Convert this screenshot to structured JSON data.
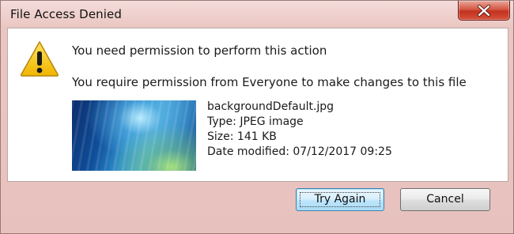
{
  "dialog": {
    "title": "File Access Denied",
    "heading": "You need permission to perform this action",
    "message": "You require permission from Everyone to make changes to this file"
  },
  "file": {
    "name": "backgroundDefault.jpg",
    "type": "Type: JPEG image",
    "size": "Size: 141 KB",
    "date_modified": "Date modified: 07/12/2017 09:25"
  },
  "buttons": {
    "try_again": "Try Again",
    "cancel": "Cancel"
  },
  "icons": {
    "close": "close-icon",
    "warning": "warning-icon"
  },
  "colors": {
    "close_button": "#c2321f",
    "warning_yellow": "#f5c400",
    "default_button_border": "#3c7fb1"
  }
}
